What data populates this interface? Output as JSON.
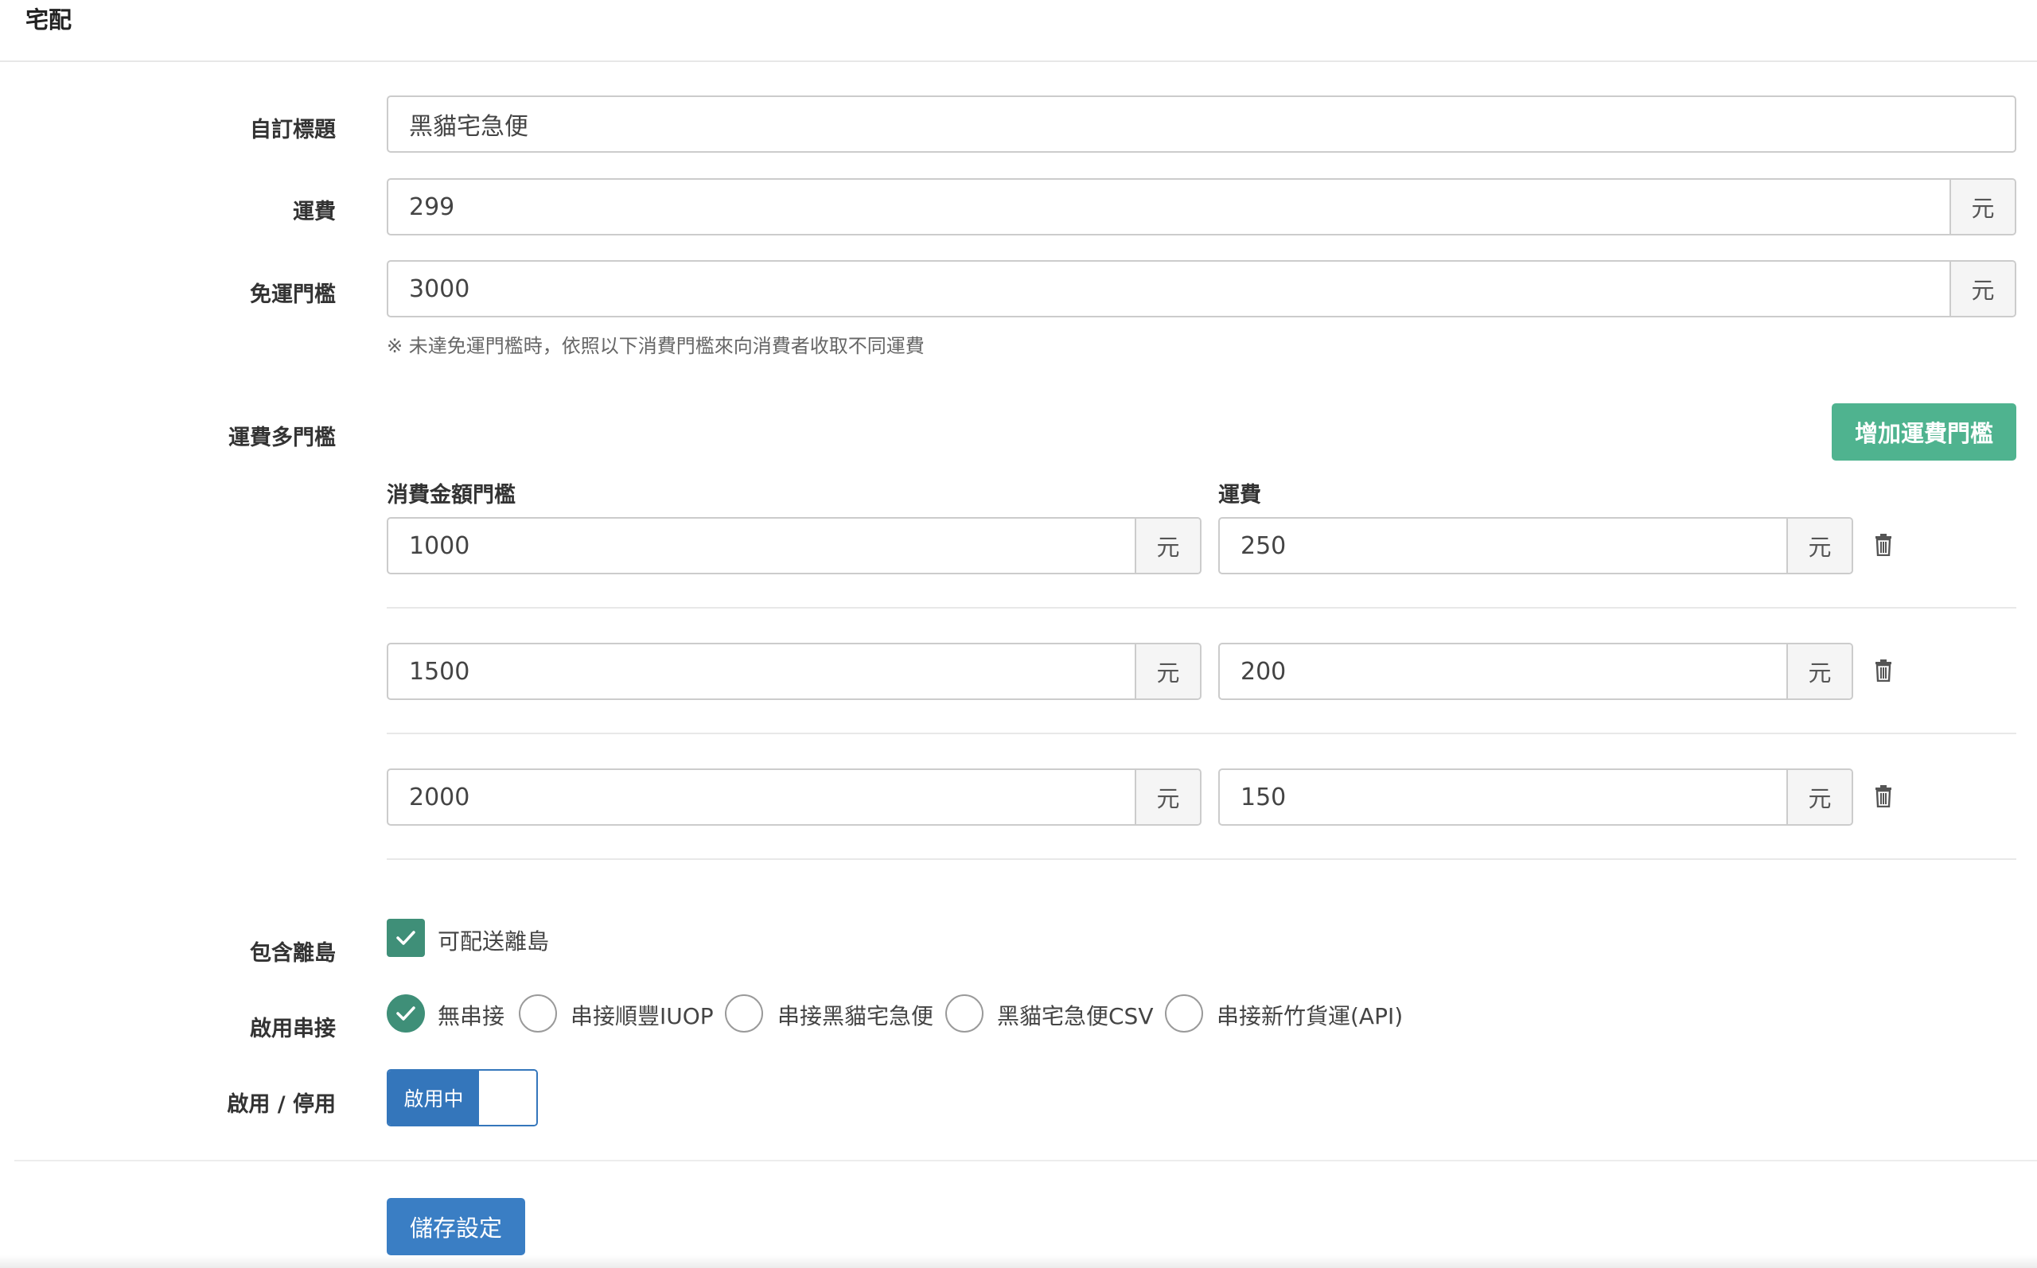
{
  "header": {
    "title": "宅配"
  },
  "form": {
    "custom_title": {
      "label": "自訂標題",
      "value": "黑貓宅急便"
    },
    "shipping_fee": {
      "label": "運費",
      "value": "299",
      "unit": "元"
    },
    "free_threshold": {
      "label": "免運門檻",
      "value": "3000",
      "unit": "元",
      "help": "※ 未達免運門檻時，依照以下消費門檻來向消費者收取不同運費"
    },
    "tiers": {
      "label": "運費多門檻",
      "add_button": "增加運費門檻",
      "col_amount": "消費金額門檻",
      "col_fee": "運費",
      "unit": "元",
      "rows": [
        {
          "amount": "1000",
          "fee": "250"
        },
        {
          "amount": "1500",
          "fee": "200"
        },
        {
          "amount": "2000",
          "fee": "150"
        }
      ]
    },
    "islands": {
      "label": "包含離島",
      "checkbox_label": "可配送離島",
      "checked": true
    },
    "integration": {
      "label": "啟用串接",
      "options": [
        {
          "label": "無串接",
          "checked": true
        },
        {
          "label": "串接順豐IUOP",
          "checked": false
        },
        {
          "label": "串接黑貓宅急便",
          "checked": false
        },
        {
          "label": "黑貓宅急便CSV",
          "checked": false
        },
        {
          "label": "串接新竹貨運(API)",
          "checked": false
        }
      ]
    },
    "status": {
      "label": "啟用 / 停用",
      "toggle_text": "啟用中",
      "enabled": true
    },
    "save_button": "儲存設定"
  },
  "colors": {
    "accent_green": "#4fb38f",
    "check_green": "#3f8f78",
    "primary_blue": "#3476bb"
  }
}
